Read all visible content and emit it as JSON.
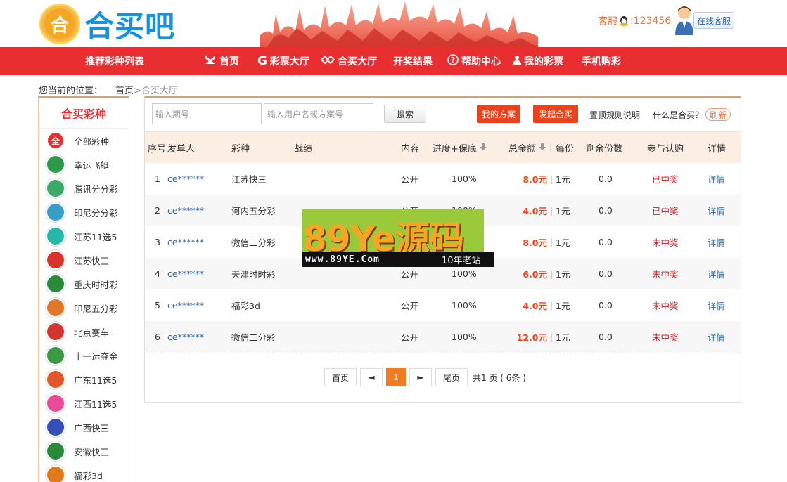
{
  "header": {
    "logo_mark": "合",
    "logo_text": "合买吧",
    "service_label": "客服",
    "service_number": ":123456",
    "online_service": "在线客服"
  },
  "nav": {
    "items": [
      {
        "label": "推荐彩种列表",
        "icon": ""
      },
      {
        "label": "首页",
        "icon": "home-icon"
      },
      {
        "label": "彩票大厅",
        "icon": "g-icon"
      },
      {
        "label": "合买大厅",
        "icon": "diamond-icon"
      },
      {
        "label": "开奖结果",
        "icon": ""
      },
      {
        "label": "帮助中心",
        "icon": "help-icon"
      },
      {
        "label": "我的彩票",
        "icon": "user-icon"
      },
      {
        "label": "手机购彩",
        "icon": ""
      }
    ]
  },
  "breadcrumb": {
    "label": "您当前的位置：",
    "home": "首页",
    "current": " >合买大厅"
  },
  "sidebar": {
    "title": "合买彩种",
    "items": [
      {
        "label": "全部彩种",
        "badge": "全",
        "color": "#e92e32"
      },
      {
        "label": "幸运飞艇",
        "badge": "",
        "color": "#2e9a48"
      },
      {
        "label": "腾讯分分彩",
        "badge": "",
        "color": "#3aa96a"
      },
      {
        "label": "印尼分分彩",
        "badge": "",
        "color": "#3a9dc9"
      },
      {
        "label": "江苏11选5",
        "badge": "",
        "color": "#25b7a8"
      },
      {
        "label": "江苏快三",
        "badge": "",
        "color": "#d9342c"
      },
      {
        "label": "重庆时时彩",
        "badge": "",
        "color": "#2a8a3c"
      },
      {
        "label": "印尼五分彩",
        "badge": "",
        "color": "#e0782a"
      },
      {
        "label": "北京赛车",
        "badge": "",
        "color": "#d6352f"
      },
      {
        "label": "十一运夺金",
        "badge": "",
        "color": "#3a9a42"
      },
      {
        "label": "广东11选5",
        "badge": "",
        "color": "#e0582a"
      },
      {
        "label": "江西11选5",
        "badge": "",
        "color": "#e84b9a"
      },
      {
        "label": "广西快三",
        "badge": "",
        "color": "#3450b8"
      },
      {
        "label": "安徽快三",
        "badge": "",
        "color": "#2a8a3c"
      },
      {
        "label": "福彩3d",
        "badge": "",
        "color": "#e07a1a"
      }
    ]
  },
  "toolbar": {
    "period_placeholder": "输入期号",
    "user_placeholder": "输入用户名或方案号",
    "search_label": "搜索",
    "my_plans": "我的方案",
    "start_group": "发起合买",
    "pin_rules": "置顶规则说明",
    "what_is": "什么是合买？",
    "refresh": "刷新"
  },
  "table": {
    "headers": {
      "no": "序号",
      "initiator": "发单人",
      "lottery": "彩种",
      "record": "战绩",
      "content": "内容",
      "progress": "进度+保底",
      "total": "总金额",
      "per_share": "每份",
      "remaining": "剩余份数",
      "subscribe": "参与认购",
      "detail": "详情"
    },
    "rows": [
      {
        "no": "1",
        "user": "ce******",
        "lottery": "江苏快三",
        "content": "公开",
        "progress": "100%",
        "amount": "8.0元",
        "sep": "|",
        "per": "1元",
        "remaining": "0.0",
        "status": "已中奖",
        "detail": "详情"
      },
      {
        "no": "2",
        "user": "ce******",
        "lottery": "河内五分彩",
        "content": "公开",
        "progress": "100%",
        "amount": "4.0元",
        "sep": "|",
        "per": "1元",
        "remaining": "0.0",
        "status": "已中奖",
        "detail": "详情"
      },
      {
        "no": "3",
        "user": "ce******",
        "lottery": "微信二分彩",
        "content": "公开",
        "progress": "100%",
        "amount": "8.0元",
        "sep": "|",
        "per": "1元",
        "remaining": "0.0",
        "status": "未中奖",
        "detail": "详情"
      },
      {
        "no": "4",
        "user": "ce******",
        "lottery": "天津时时彩",
        "content": "公开",
        "progress": "100%",
        "amount": "6.0元",
        "sep": "|",
        "per": "1元",
        "remaining": "0.0",
        "status": "未中奖",
        "detail": "详情"
      },
      {
        "no": "5",
        "user": "ce******",
        "lottery": "福彩3d",
        "content": "公开",
        "progress": "100%",
        "amount": "4.0元",
        "sep": "|",
        "per": "1元",
        "remaining": "0.0",
        "status": "未中奖",
        "detail": "详情"
      },
      {
        "no": "6",
        "user": "ce******",
        "lottery": "微信二分彩",
        "content": "公开",
        "progress": "100%",
        "amount": "12.0元",
        "sep": "|",
        "per": "1元",
        "remaining": "0.0",
        "status": "未中奖",
        "detail": "详情"
      }
    ]
  },
  "pager": {
    "first": "首页",
    "prev": "◄",
    "current": "1",
    "next": "►",
    "last": "尾页",
    "info": "共1 页 ( 6条 )"
  },
  "watermark": {
    "big": "89Ye源码",
    "url": "www.89YE.Com",
    "years": "10年老站"
  },
  "colors": {
    "brand_red": "#e92e32",
    "accent_orange": "#f47a20",
    "link_blue": "#336699"
  }
}
